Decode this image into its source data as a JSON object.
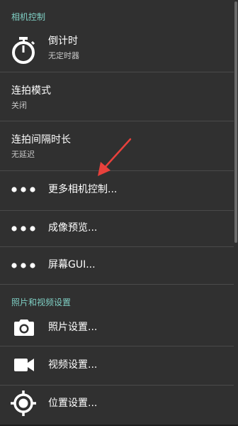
{
  "sections": {
    "camera_controls": "相机控制",
    "photo_video": "照片和视频设置"
  },
  "items": {
    "timer": {
      "title": "倒计时",
      "summary": "无定时器",
      "icon": "stopwatch-icon"
    },
    "burst_mode": {
      "title": "连拍模式",
      "summary": "关闭"
    },
    "burst_interval": {
      "title": "连拍间隔时长",
      "summary": "无延迟"
    },
    "more_camera": {
      "title": "更多相机控制...",
      "icon": "more-dots-icon"
    },
    "preview": {
      "title": "成像预览...",
      "icon": "more-dots-icon"
    },
    "screen_gui": {
      "title": "屏幕GUI...",
      "icon": "more-dots-icon"
    },
    "photo_settings": {
      "title": "照片设置...",
      "icon": "camera-icon"
    },
    "video_settings": {
      "title": "视频设置...",
      "icon": "video-camera-icon"
    },
    "location_settings": {
      "title": "位置设置...",
      "icon": "gps-location-icon"
    }
  },
  "colors": {
    "background": "#303030",
    "section_accent": "#7fcfc4",
    "annotation_arrow": "#e8413c"
  }
}
